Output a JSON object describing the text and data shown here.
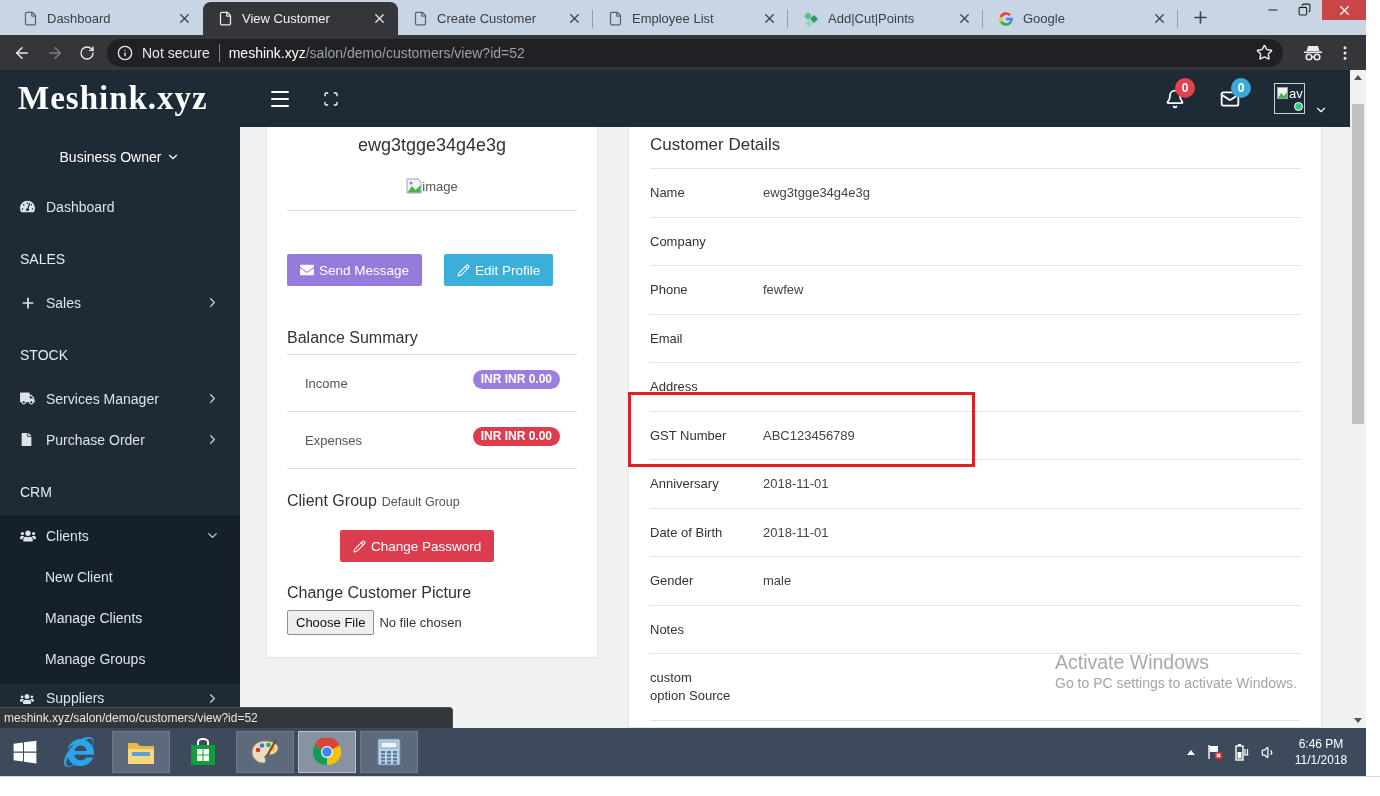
{
  "browser": {
    "tabs": [
      {
        "title": "Dashboard",
        "kind": "page",
        "selected": false
      },
      {
        "title": "View Customer",
        "kind": "page",
        "selected": true
      },
      {
        "title": "Create Customer",
        "kind": "page",
        "selected": false
      },
      {
        "title": "Employee List",
        "kind": "page",
        "selected": false
      },
      {
        "title": "Add|Cut|Points",
        "kind": "diamond",
        "selected": false
      },
      {
        "title": "Google",
        "kind": "g",
        "selected": false
      }
    ],
    "forward_disabled": true,
    "address": {
      "security": "Not secure",
      "host": "meshink.xyz",
      "path": "/salon/demo/customers/view?id=52"
    },
    "status_link": "meshink.xyz/salon/demo/customers/view?id=52"
  },
  "header": {
    "logo": "Meshink.xyz",
    "notifications": "0",
    "messages": "0",
    "avatar_alt": "av"
  },
  "sidebar": {
    "user": "Business Owner",
    "menu": [
      {
        "kind": "link",
        "label": "Dashboard"
      },
      {
        "kind": "heading",
        "label": "SALES"
      },
      {
        "kind": "menu",
        "label": "Sales",
        "expanded": false
      },
      {
        "kind": "heading",
        "label": "STOCK"
      },
      {
        "kind": "menu",
        "label": "Services Manager",
        "expanded": false
      },
      {
        "kind": "menu",
        "label": "Purchase Order",
        "expanded": false
      },
      {
        "kind": "heading",
        "label": "CRM"
      },
      {
        "kind": "menu",
        "label": "Clients",
        "expanded": true,
        "children": [
          {
            "label": "New Client"
          },
          {
            "label": "Manage Clients"
          },
          {
            "label": "Manage Groups"
          }
        ]
      },
      {
        "kind": "menu",
        "label": "Suppliers",
        "expanded": false
      }
    ]
  },
  "profile": {
    "name": "ewg3tgge34g4e3g",
    "image_alt": "image",
    "actions": [
      {
        "label": "Send Message",
        "color": "#967bdc"
      },
      {
        "label": "Edit Profile",
        "color": "#3bafda"
      }
    ],
    "balance_title": "Balance Summary",
    "balance": [
      {
        "label": "Income",
        "amount": "INR INR 0.00",
        "color": "#9a7fde"
      },
      {
        "label": "Expenses",
        "amount": "INR INR 0.00",
        "color": "#de3b4d"
      }
    ],
    "group_label": "Client Group",
    "group_value": "Default Group",
    "password_button": "Change Password",
    "picture_title": "Change Customer Picture",
    "file_button": "Choose File",
    "file_status": "No file chosen"
  },
  "details": {
    "title": "Customer Details",
    "rows": [
      {
        "label": "Name",
        "value": "ewg3tgge34g4e3g"
      },
      {
        "label": "Company"
      },
      {
        "label": "Phone",
        "value": "fewfew"
      },
      {
        "label": "Email"
      },
      {
        "label": "Address"
      },
      {
        "label": "GST Number",
        "value": "ABC123456789"
      },
      {
        "label": "Anniversary",
        "value": "2018-11-01"
      },
      {
        "label": "Date of Birth",
        "value": "2018-11-01"
      },
      {
        "label": "Gender",
        "value": "male"
      },
      {
        "label": "Notes"
      },
      {
        "label": "custom\noption Source"
      }
    ]
  },
  "os_notice": {
    "title": "Activate Windows",
    "message": "Go to PC settings to activate Windows."
  },
  "taskbar": {
    "apps": [
      {
        "running": false,
        "selected": false
      },
      {
        "running": true,
        "selected": false
      },
      {
        "running": false,
        "selected": false
      },
      {
        "running": true,
        "selected": false
      },
      {
        "running": true,
        "selected": true
      },
      {
        "running": true,
        "selected": false
      }
    ],
    "time": "6:46 PM",
    "date": "11/1/2018"
  }
}
